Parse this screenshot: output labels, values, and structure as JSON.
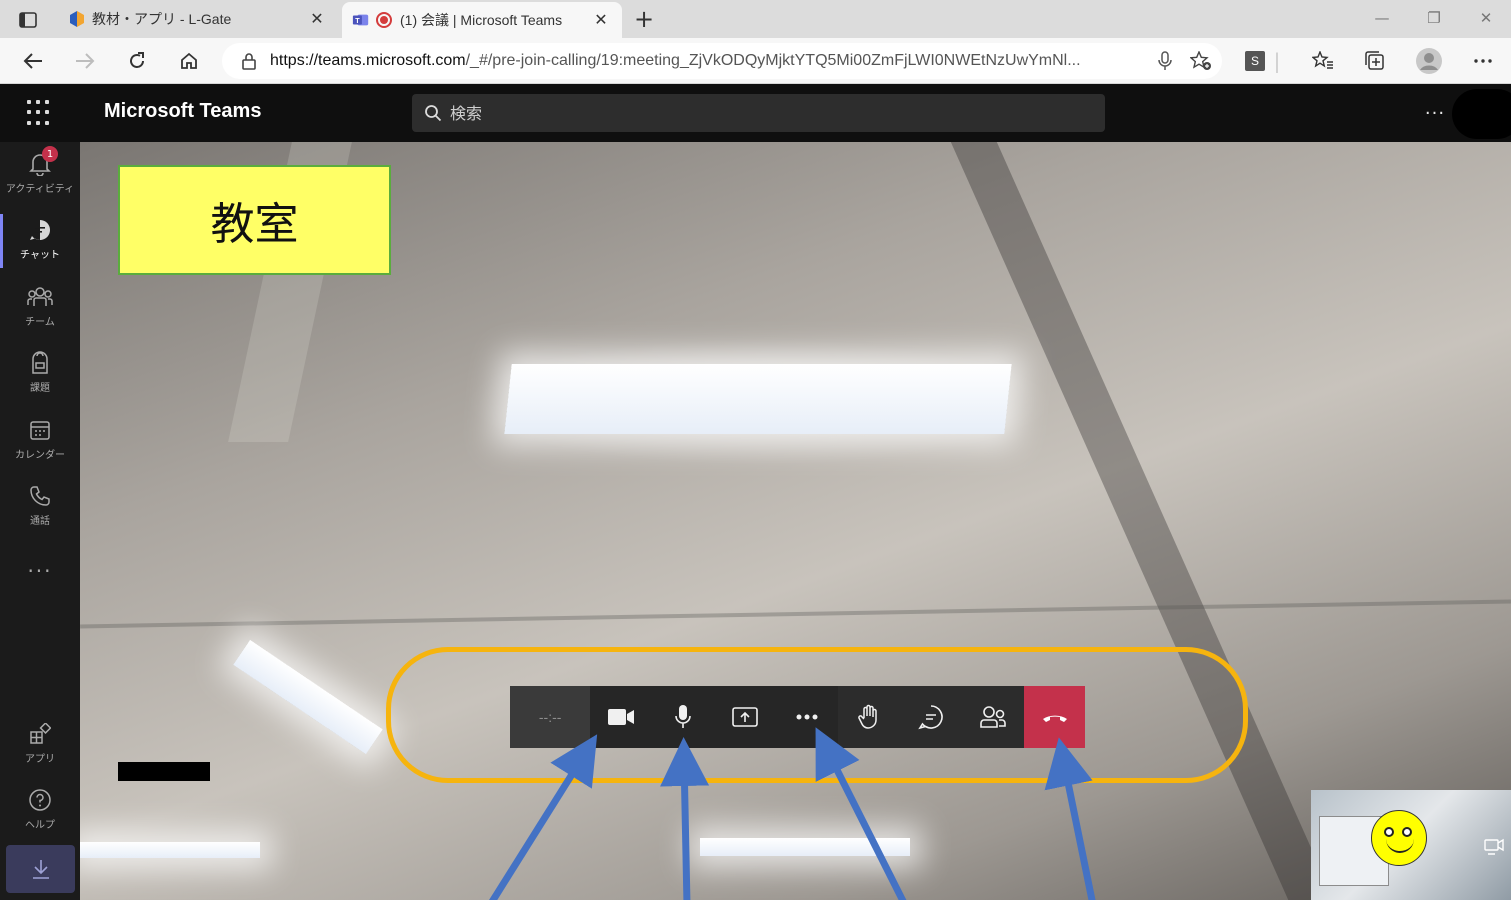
{
  "browser": {
    "tabs": [
      {
        "label": "教材・アプリ - L-Gate",
        "active": false
      },
      {
        "label": "(1) 会議 | Microsoft Teams",
        "active": true,
        "recording": true
      }
    ],
    "url": {
      "host": "https://teams.microsoft.com",
      "path": "/_#/pre-join-calling/19:meeting_ZjVkODQyMjktYTQ5Mi00ZmFjLWI0NWEtNzUwYmNl..."
    },
    "profile_letter": "S"
  },
  "teams": {
    "app_title": "Microsoft Teams",
    "search_placeholder": "検索",
    "rail": {
      "activity": {
        "label": "アクティビティ",
        "badge": "1"
      },
      "chat": {
        "label": "チャット"
      },
      "teams": {
        "label": "チーム"
      },
      "assignments": {
        "label": "課題"
      },
      "calendar": {
        "label": "カレンダー"
      },
      "calls": {
        "label": "通話"
      },
      "more": "···",
      "apps": {
        "label": "アプリ"
      },
      "help": {
        "label": "ヘルプ"
      }
    }
  },
  "meeting": {
    "room_label": "教室",
    "timer": "--:--",
    "controls": [
      "camera",
      "microphone",
      "share-screen",
      "more-actions",
      "raise-hand",
      "chat",
      "participants",
      "leave"
    ]
  },
  "colors": {
    "highlight_border": "#f6b40e",
    "arrow": "#4472c4",
    "hangup": "#c4314b",
    "room_label_bg": "#ffff66",
    "room_label_border": "#5aad3c",
    "teams_accent": "#7f85f5"
  }
}
